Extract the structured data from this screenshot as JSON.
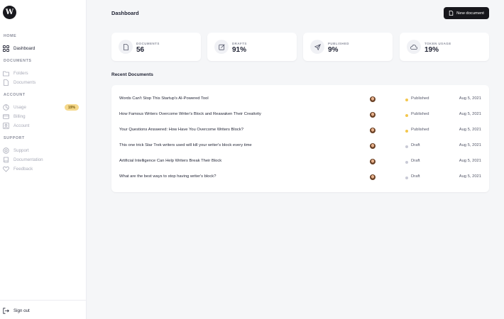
{
  "app": {
    "logo_letter": "W"
  },
  "sidebar": {
    "sections": [
      {
        "title": "HOME",
        "items": [
          {
            "label": "Dashboard",
            "icon": "grid-icon",
            "active": true
          }
        ]
      },
      {
        "title": "DOCUMENTS",
        "items": [
          {
            "label": "Folders",
            "icon": "folder-icon"
          },
          {
            "label": "Documents",
            "icon": "document-icon"
          }
        ]
      },
      {
        "title": "ACCOUNT",
        "items": [
          {
            "label": "Usage",
            "icon": "chart-icon",
            "badge": "19%"
          },
          {
            "label": "Billing",
            "icon": "credit-card-icon"
          },
          {
            "label": "Account",
            "icon": "user-icon"
          }
        ]
      },
      {
        "title": "SUPPORT",
        "items": [
          {
            "label": "Support",
            "icon": "lifebuoy-icon"
          },
          {
            "label": "Documentation",
            "icon": "book-icon"
          },
          {
            "label": "Feedback",
            "icon": "heart-icon"
          }
        ]
      }
    ],
    "sign_out": "Sign out"
  },
  "header": {
    "title": "Dashboard",
    "new_button": "New document"
  },
  "stats": [
    {
      "label": "DOCUMENTS",
      "value": "56",
      "icon": "document-icon"
    },
    {
      "label": "DRAFTS",
      "value": "91%",
      "icon": "edit-icon"
    },
    {
      "label": "PUBLISHED",
      "value": "9%",
      "icon": "send-icon"
    },
    {
      "label": "TOKEN USAGE",
      "value": "19%",
      "icon": "cloud-icon"
    }
  ],
  "recent": {
    "title": "Recent Documents",
    "rows": [
      {
        "title": "Words Can't Stop This Startup's AI-Powered Tool",
        "status": "Published",
        "date": "Aug 5, 2021"
      },
      {
        "title": "How Famous Writers Overcome Writer's Block and Reawaken Their Creativity",
        "status": "Published",
        "date": "Aug 5, 2021"
      },
      {
        "title": "Your Questions Answered: How Have You Overcome Writers Block?",
        "status": "Published",
        "date": "Aug 5, 2021"
      },
      {
        "title": "This one trick Star Trek writers used will kill your writer's block every time",
        "status": "Draft",
        "date": "Aug 5, 2021"
      },
      {
        "title": "Artificial Intelligence Can Help Writers Break Their Block",
        "status": "Draft",
        "date": "Aug 5, 2021"
      },
      {
        "title": "What are the best ways to stop having writer's block?",
        "status": "Draft",
        "date": "Aug 5, 2021"
      }
    ]
  },
  "colors": {
    "published": "#f3c74d",
    "draft": "#c9cad6",
    "accent": "#17171c"
  }
}
